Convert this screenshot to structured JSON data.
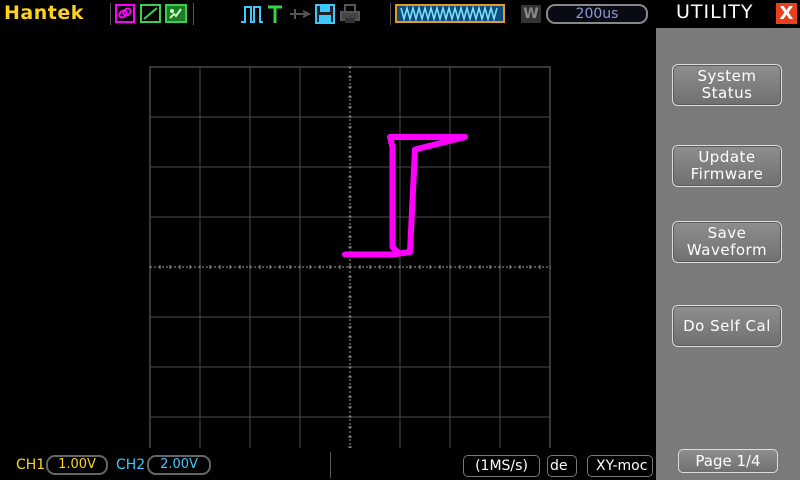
{
  "brand": "Hantek",
  "timebase": "200us",
  "w_icon": "W",
  "icons": [
    "channel-link-icon",
    "line-icon",
    "math-icon",
    "trigger-edge-icon",
    "trigger-t-icon",
    "trigger-level-icon",
    "save-disk-icon",
    "printer-icon",
    "waveform-memory-icon"
  ],
  "colors": {
    "trace": "#ff00ff",
    "brand": "#ffd21e",
    "ch1": "#ffd21e",
    "ch2": "#3cc8ff",
    "menu_bg": "#7a7a7a",
    "close": "#e8401c"
  },
  "bottom": {
    "ch1_label": "CH1",
    "ch1_value": "1.00V",
    "ch2_label": "CH2",
    "ch2_value": "2.00V",
    "sample_rate": "(1MS/s)",
    "mode_partial": "de",
    "mode": "XY-moc"
  },
  "menu": {
    "title": "UTILITY",
    "close": "X",
    "buttons": [
      {
        "line1": "System",
        "line2": "Status"
      },
      {
        "line1": "Update",
        "line2": "Firmware"
      },
      {
        "line1": "Save",
        "line2": "Waveform"
      },
      {
        "line1": "Do Self Cal",
        "line2": ""
      }
    ],
    "page": "Page 1/4"
  },
  "trace_xy": {
    "x_div_range": [
      -4,
      4
    ],
    "y_div_range": [
      -4,
      4
    ],
    "loop": [
      [
        -0.1,
        0.25
      ],
      [
        0.85,
        0.25
      ],
      [
        1.2,
        0.3
      ],
      [
        1.3,
        2.35
      ],
      [
        2.3,
        2.6
      ],
      [
        0.8,
        2.6
      ],
      [
        0.85,
        2.4
      ],
      [
        0.85,
        0.4
      ],
      [
        0.95,
        0.3
      ]
    ]
  }
}
